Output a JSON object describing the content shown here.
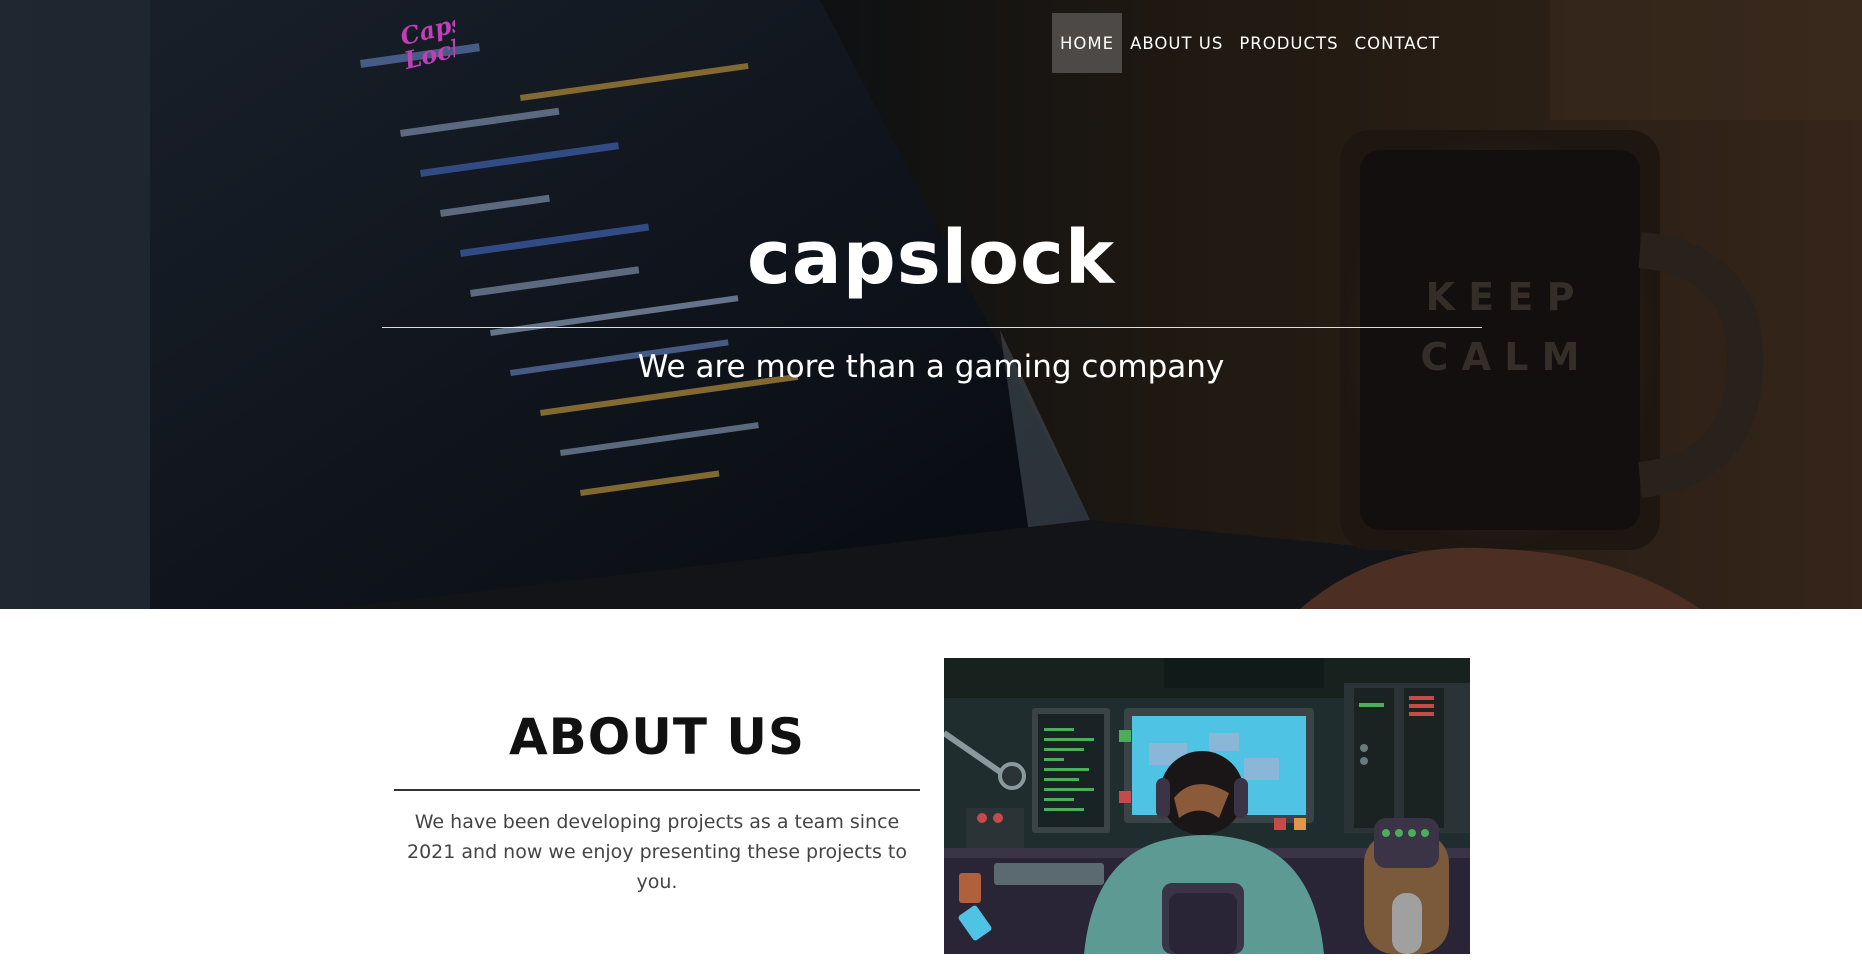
{
  "nav": {
    "items": [
      {
        "label": "HOME",
        "active": true
      },
      {
        "label": "ABOUT US",
        "active": false
      },
      {
        "label": "PRODUCTS",
        "active": false
      },
      {
        "label": "CONTACT",
        "active": false
      }
    ]
  },
  "hero": {
    "title": "capslock",
    "subtitle": "We are more than a gaming company"
  },
  "about": {
    "title": "ABOUT US",
    "body": "We have been developing projects as a team since 2021 and now we enjoy presenting these projects to you."
  },
  "colors": {
    "logo": "#c23fb8",
    "text_light": "#ffffff",
    "text_dark": "#111111",
    "body_text": "#444444"
  },
  "icons": {
    "logo": "capslock-logo",
    "illustration": "gamer-at-desk-illustration"
  }
}
